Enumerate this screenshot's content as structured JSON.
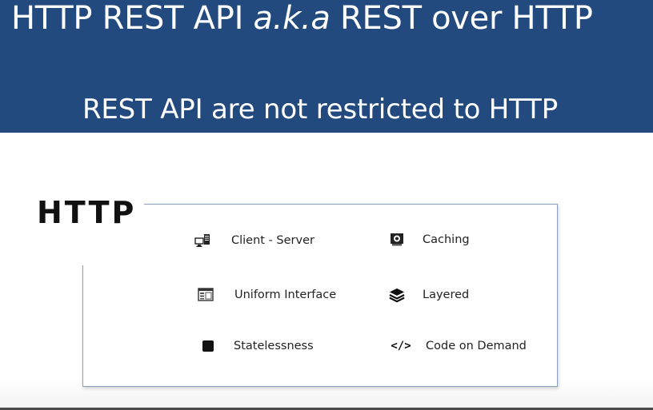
{
  "slide": {
    "title_prefix": "HTTP REST API ",
    "title_aka": "a.k.a",
    "title_suffix": "  REST over HTTP",
    "subtitle": "REST API are not restricted to HTTP"
  },
  "panel": {
    "label": "HTTP",
    "features": [
      {
        "label": "Client - Server",
        "icon": "client-server-icon"
      },
      {
        "label": "Uniform Interface",
        "icon": "uniform-interface-icon"
      },
      {
        "label": "Statelessness",
        "icon": "stateless-icon"
      },
      {
        "label": "Caching",
        "icon": "caching-icon"
      },
      {
        "label": "Layered",
        "icon": "layers-icon"
      },
      {
        "label": "Code on Demand",
        "icon": "code-icon",
        "glyph": "</>"
      }
    ]
  },
  "colors": {
    "banner": "#234a7f",
    "banner_text": "#ffffff",
    "body_text": "#222222"
  }
}
